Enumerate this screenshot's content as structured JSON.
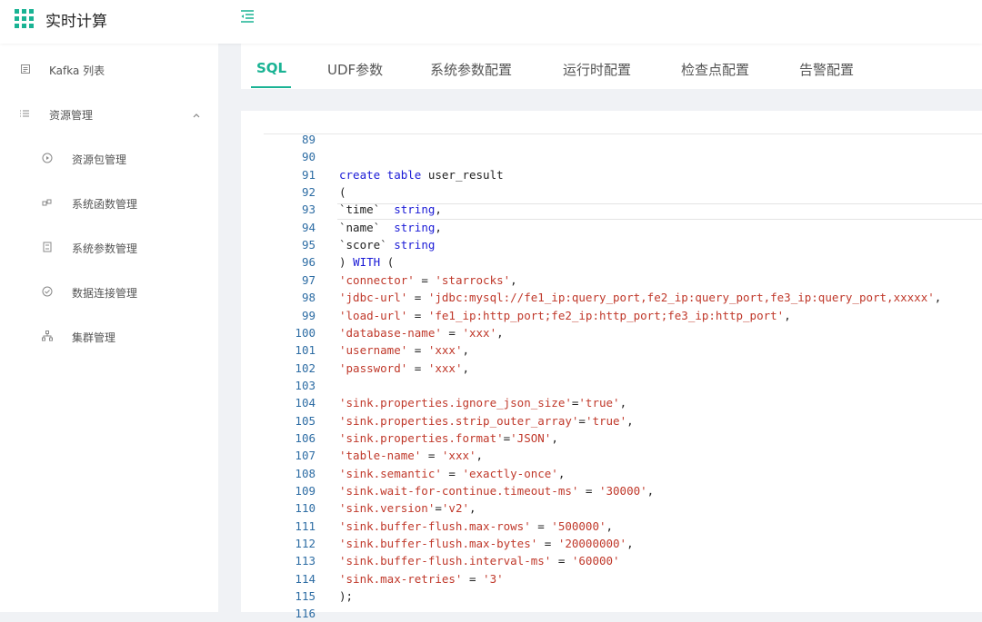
{
  "app": {
    "title": "实时计算",
    "logo_icon": "grid-icon",
    "menu_toggle_icon": "menu-fold-icon"
  },
  "sidebar": {
    "items": [
      {
        "label": "Kafka 列表",
        "icon": "list-icon"
      },
      {
        "label": "资源管理",
        "icon": "bars-icon",
        "expanded": true
      },
      {
        "label": "资源包管理",
        "icon": "play-circle-icon"
      },
      {
        "label": "系统函数管理",
        "icon": "function-icon"
      },
      {
        "label": "系统参数管理",
        "icon": "book-icon"
      },
      {
        "label": "数据连接管理",
        "icon": "check-circle-icon"
      },
      {
        "label": "集群管理",
        "icon": "cluster-icon"
      }
    ]
  },
  "tabs": [
    {
      "label": "SQL",
      "active": true
    },
    {
      "label": "UDF参数"
    },
    {
      "label": "系统参数配置"
    },
    {
      "label": "运行时配置"
    },
    {
      "label": "检查点配置"
    },
    {
      "label": "告警配置"
    }
  ],
  "colors": {
    "accent": "#1ab394",
    "keyword": "#1a1ad6",
    "string": "#c0392b",
    "line_number": "#2e6da4"
  },
  "editor": {
    "lines": [
      {
        "n": "89",
        "tokens": []
      },
      {
        "n": "90",
        "tokens": []
      },
      {
        "n": "91",
        "tokens": [
          {
            "t": "kw",
            "v": "create table"
          },
          {
            "t": "txt",
            "v": " user_result"
          }
        ]
      },
      {
        "n": "92",
        "tokens": [
          {
            "t": "txt",
            "v": "("
          }
        ]
      },
      {
        "n": "93",
        "tokens": [
          {
            "t": "txt",
            "v": "`time`  "
          },
          {
            "t": "kw",
            "v": "string"
          },
          {
            "t": "txt",
            "v": ","
          }
        ]
      },
      {
        "n": "94",
        "tokens": [
          {
            "t": "txt",
            "v": "`name`  "
          },
          {
            "t": "kw",
            "v": "string"
          },
          {
            "t": "txt",
            "v": ","
          }
        ]
      },
      {
        "n": "95",
        "tokens": [
          {
            "t": "txt",
            "v": "`score` "
          },
          {
            "t": "kw",
            "v": "string"
          }
        ]
      },
      {
        "n": "96",
        "tokens": [
          {
            "t": "txt",
            "v": ") "
          },
          {
            "t": "kw",
            "v": "WITH"
          },
          {
            "t": "txt",
            "v": " ("
          }
        ]
      },
      {
        "n": "97",
        "tokens": [
          {
            "t": "str",
            "v": "'connector'"
          },
          {
            "t": "txt",
            "v": " = "
          },
          {
            "t": "str",
            "v": "'starrocks'"
          },
          {
            "t": "txt",
            "v": ","
          }
        ]
      },
      {
        "n": "98",
        "tokens": [
          {
            "t": "str",
            "v": "'jdbc-url'"
          },
          {
            "t": "txt",
            "v": " = "
          },
          {
            "t": "str",
            "v": "'jdbc:mysql://fe1_ip:query_port,fe2_ip:query_port,fe3_ip:query_port,xxxxx'"
          },
          {
            "t": "txt",
            "v": ","
          }
        ]
      },
      {
        "n": "99",
        "tokens": [
          {
            "t": "str",
            "v": "'load-url'"
          },
          {
            "t": "txt",
            "v": " = "
          },
          {
            "t": "str",
            "v": "'fe1_ip:http_port;fe2_ip:http_port;fe3_ip:http_port'"
          },
          {
            "t": "txt",
            "v": ","
          }
        ]
      },
      {
        "n": "100",
        "tokens": [
          {
            "t": "str",
            "v": "'database-name'"
          },
          {
            "t": "txt",
            "v": " = "
          },
          {
            "t": "str",
            "v": "'xxx'"
          },
          {
            "t": "txt",
            "v": ","
          }
        ]
      },
      {
        "n": "101",
        "tokens": [
          {
            "t": "str",
            "v": "'username'"
          },
          {
            "t": "txt",
            "v": " = "
          },
          {
            "t": "str",
            "v": "'xxx'"
          },
          {
            "t": "txt",
            "v": ","
          }
        ]
      },
      {
        "n": "102",
        "tokens": [
          {
            "t": "str",
            "v": "'password'"
          },
          {
            "t": "txt",
            "v": " = "
          },
          {
            "t": "str",
            "v": "'xxx'"
          },
          {
            "t": "txt",
            "v": ","
          }
        ]
      },
      {
        "n": "103",
        "tokens": []
      },
      {
        "n": "104",
        "tokens": [
          {
            "t": "str",
            "v": "'sink.properties.ignore_json_size'"
          },
          {
            "t": "txt",
            "v": "="
          },
          {
            "t": "str",
            "v": "'true'"
          },
          {
            "t": "txt",
            "v": ","
          }
        ]
      },
      {
        "n": "105",
        "tokens": [
          {
            "t": "str",
            "v": "'sink.properties.strip_outer_array'"
          },
          {
            "t": "txt",
            "v": "="
          },
          {
            "t": "str",
            "v": "'true'"
          },
          {
            "t": "txt",
            "v": ","
          }
        ]
      },
      {
        "n": "106",
        "tokens": [
          {
            "t": "str",
            "v": "'sink.properties.format'"
          },
          {
            "t": "txt",
            "v": "="
          },
          {
            "t": "str",
            "v": "'JSON'"
          },
          {
            "t": "txt",
            "v": ","
          }
        ]
      },
      {
        "n": "107",
        "tokens": [
          {
            "t": "str",
            "v": "'table-name'"
          },
          {
            "t": "txt",
            "v": " = "
          },
          {
            "t": "str",
            "v": "'xxx'"
          },
          {
            "t": "txt",
            "v": ","
          }
        ]
      },
      {
        "n": "108",
        "tokens": [
          {
            "t": "str",
            "v": "'sink.semantic'"
          },
          {
            "t": "txt",
            "v": " = "
          },
          {
            "t": "str",
            "v": "'exactly-once'"
          },
          {
            "t": "txt",
            "v": ","
          }
        ]
      },
      {
        "n": "109",
        "tokens": [
          {
            "t": "str",
            "v": "'sink.wait-for-continue.timeout-ms'"
          },
          {
            "t": "txt",
            "v": " = "
          },
          {
            "t": "str",
            "v": "'30000'"
          },
          {
            "t": "txt",
            "v": ","
          }
        ]
      },
      {
        "n": "110",
        "tokens": [
          {
            "t": "str",
            "v": "'sink.version'"
          },
          {
            "t": "txt",
            "v": "="
          },
          {
            "t": "str",
            "v": "'v2'"
          },
          {
            "t": "txt",
            "v": ","
          }
        ]
      },
      {
        "n": "111",
        "tokens": [
          {
            "t": "str",
            "v": "'sink.buffer-flush.max-rows'"
          },
          {
            "t": "txt",
            "v": " = "
          },
          {
            "t": "str",
            "v": "'500000'"
          },
          {
            "t": "txt",
            "v": ","
          }
        ]
      },
      {
        "n": "112",
        "tokens": [
          {
            "t": "str",
            "v": "'sink.buffer-flush.max-bytes'"
          },
          {
            "t": "txt",
            "v": " = "
          },
          {
            "t": "str",
            "v": "'20000000'"
          },
          {
            "t": "txt",
            "v": ","
          }
        ]
      },
      {
        "n": "113",
        "tokens": [
          {
            "t": "str",
            "v": "'sink.buffer-flush.interval-ms'"
          },
          {
            "t": "txt",
            "v": " = "
          },
          {
            "t": "str",
            "v": "'60000'"
          }
        ]
      },
      {
        "n": "114",
        "tokens": [
          {
            "t": "str",
            "v": "'sink.max-retries'"
          },
          {
            "t": "txt",
            "v": " = "
          },
          {
            "t": "str",
            "v": "'3'"
          }
        ]
      },
      {
        "n": "115",
        "tokens": [
          {
            "t": "txt",
            "v": ");"
          }
        ]
      },
      {
        "n": "116",
        "tokens": []
      }
    ]
  }
}
